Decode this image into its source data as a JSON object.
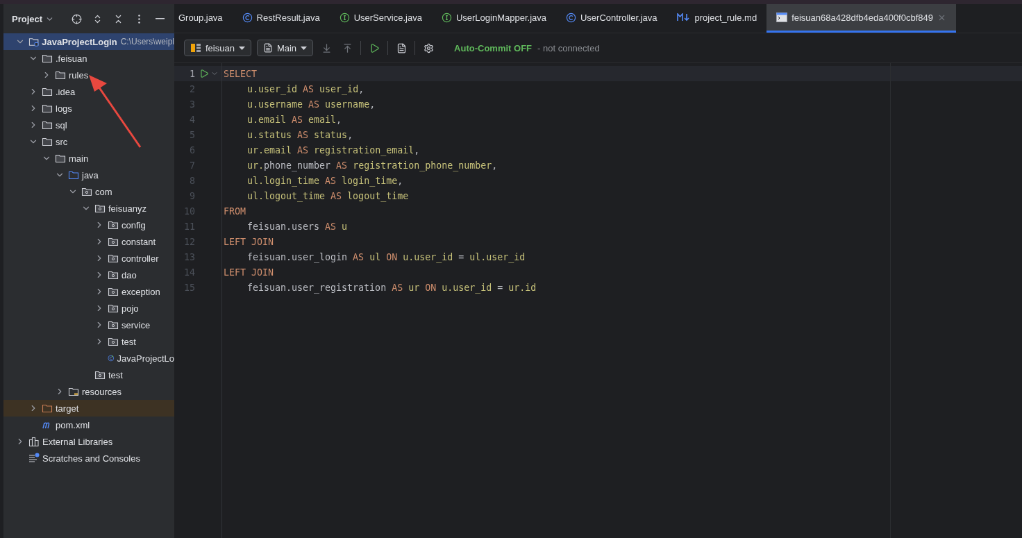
{
  "project_panel": {
    "title": "Project",
    "tree": [
      {
        "label": "JavaProjectLogin",
        "path": "C:\\Users\\weipl",
        "kind": "module",
        "expanded": true,
        "selected": true,
        "children": [
          {
            "label": ".feisuan",
            "kind": "folder",
            "expanded": true,
            "selected": false,
            "children": [
              {
                "label": "rules",
                "kind": "folder",
                "expanded": false,
                "selected": false
              }
            ]
          },
          {
            "label": ".idea",
            "kind": "folder",
            "expanded": false,
            "selected": false
          },
          {
            "label": "logs",
            "kind": "folder",
            "expanded": false,
            "selected": false
          },
          {
            "label": "sql",
            "kind": "folder",
            "expanded": false,
            "selected": false
          },
          {
            "label": "src",
            "kind": "folder",
            "expanded": true,
            "selected": false,
            "children": [
              {
                "label": "main",
                "kind": "folder",
                "expanded": true,
                "selected": false,
                "children": [
                  {
                    "label": "java",
                    "kind": "source",
                    "expanded": true,
                    "selected": false,
                    "children": [
                      {
                        "label": "com",
                        "kind": "package",
                        "expanded": true,
                        "selected": false,
                        "children": [
                          {
                            "label": "feisuanyz",
                            "kind": "package",
                            "expanded": true,
                            "selected": false,
                            "children": [
                              {
                                "label": "config",
                                "kind": "package",
                                "expanded": false,
                                "selected": false
                              },
                              {
                                "label": "constant",
                                "kind": "package",
                                "expanded": false,
                                "selected": false
                              },
                              {
                                "label": "controller",
                                "kind": "package",
                                "expanded": false,
                                "selected": false
                              },
                              {
                                "label": "dao",
                                "kind": "package",
                                "expanded": false,
                                "selected": false
                              },
                              {
                                "label": "exception",
                                "kind": "package",
                                "expanded": false,
                                "selected": false
                              },
                              {
                                "label": "pojo",
                                "kind": "package",
                                "expanded": false,
                                "selected": false
                              },
                              {
                                "label": "service",
                                "kind": "package",
                                "expanded": false,
                                "selected": false
                              },
                              {
                                "label": "test",
                                "kind": "package",
                                "expanded": false,
                                "selected": false
                              },
                              {
                                "label": "JavaProjectLo",
                                "kind": "class",
                                "selected": false
                              }
                            ]
                          },
                          {
                            "label": "test",
                            "kind": "package",
                            "selected": false
                          }
                        ]
                      }
                    ]
                  },
                  {
                    "label": "resources",
                    "kind": "resources",
                    "expanded": false,
                    "selected": false
                  }
                ]
              }
            ]
          },
          {
            "label": "target",
            "kind": "excluded",
            "expanded": false,
            "selected": false
          },
          {
            "label": "pom.xml",
            "kind": "maven",
            "selected": false
          }
        ]
      },
      {
        "label": "External Libraries",
        "kind": "libraries",
        "expanded": false,
        "selected": false
      },
      {
        "label": "Scratches and Consoles",
        "kind": "scratches",
        "selected": false
      }
    ]
  },
  "tabs": [
    {
      "label": "Group.java",
      "kind": "plain",
      "selected": false
    },
    {
      "label": "RestResult.java",
      "kind": "class",
      "selected": false
    },
    {
      "label": "UserService.java",
      "kind": "interface",
      "selected": false
    },
    {
      "label": "UserLoginMapper.java",
      "kind": "interface",
      "selected": false
    },
    {
      "label": "UserController.java",
      "kind": "class",
      "selected": false
    },
    {
      "label": "project_rule.md",
      "kind": "markdown",
      "selected": false
    },
    {
      "label": "feisuan68a428dfb4eda400f0cbf849",
      "kind": "console",
      "selected": true
    }
  ],
  "toolbar": {
    "datasource": "feisuan",
    "session": "Main",
    "auto_commit": "Auto-Commit OFF",
    "status": "- not connected"
  },
  "editor": {
    "lines": [
      {
        "n": "1",
        "current": true,
        "indent": false,
        "tokens": [
          {
            "kind": "kw",
            "text": "SELECT"
          }
        ]
      },
      {
        "n": "2",
        "current": false,
        "indent": true,
        "tokens": [
          {
            "kind": "col",
            "text": "u.user_id"
          },
          {
            "kind": "kw",
            "text": " AS "
          },
          {
            "kind": "col",
            "text": "user_id"
          },
          {
            "kind": "plain",
            "text": ","
          }
        ]
      },
      {
        "n": "3",
        "current": false,
        "indent": true,
        "tokens": [
          {
            "kind": "col",
            "text": "u.username"
          },
          {
            "kind": "kw",
            "text": " AS "
          },
          {
            "kind": "col",
            "text": "username"
          },
          {
            "kind": "plain",
            "text": ","
          }
        ]
      },
      {
        "n": "4",
        "current": false,
        "indent": true,
        "tokens": [
          {
            "kind": "col",
            "text": "u.email"
          },
          {
            "kind": "kw",
            "text": " AS "
          },
          {
            "kind": "col",
            "text": "email"
          },
          {
            "kind": "plain",
            "text": ","
          }
        ]
      },
      {
        "n": "5",
        "current": false,
        "indent": true,
        "tokens": [
          {
            "kind": "col",
            "text": "u.status"
          },
          {
            "kind": "kw",
            "text": " AS "
          },
          {
            "kind": "col",
            "text": "status"
          },
          {
            "kind": "plain",
            "text": ","
          }
        ]
      },
      {
        "n": "6",
        "current": false,
        "indent": true,
        "tokens": [
          {
            "kind": "col",
            "text": "ur.email"
          },
          {
            "kind": "kw",
            "text": " AS "
          },
          {
            "kind": "col",
            "text": "registration_email"
          },
          {
            "kind": "plain",
            "text": ","
          }
        ]
      },
      {
        "n": "7",
        "current": false,
        "indent": true,
        "tokens": [
          {
            "kind": "col",
            "text": "ur."
          },
          {
            "kind": "plain",
            "text": "phone_number"
          },
          {
            "kind": "kw",
            "text": " AS "
          },
          {
            "kind": "col",
            "text": "registration_phone_number"
          },
          {
            "kind": "plain",
            "text": ","
          }
        ]
      },
      {
        "n": "8",
        "current": false,
        "indent": true,
        "tokens": [
          {
            "kind": "col",
            "text": "ul.login_time"
          },
          {
            "kind": "kw",
            "text": " AS "
          },
          {
            "kind": "col",
            "text": "login_time"
          },
          {
            "kind": "plain",
            "text": ","
          }
        ]
      },
      {
        "n": "9",
        "current": false,
        "indent": true,
        "tokens": [
          {
            "kind": "col",
            "text": "ul.logout_time"
          },
          {
            "kind": "kw",
            "text": " AS "
          },
          {
            "kind": "col",
            "text": "logout_time"
          }
        ]
      },
      {
        "n": "10",
        "current": false,
        "indent": false,
        "tokens": [
          {
            "kind": "kw",
            "text": "FROM"
          }
        ]
      },
      {
        "n": "11",
        "current": false,
        "indent": true,
        "tokens": [
          {
            "kind": "plain",
            "text": "feisuan.users"
          },
          {
            "kind": "kw",
            "text": " AS "
          },
          {
            "kind": "col",
            "text": "u"
          }
        ]
      },
      {
        "n": "12",
        "current": false,
        "indent": false,
        "tokens": [
          {
            "kind": "kw",
            "text": "LEFT JOIN"
          }
        ]
      },
      {
        "n": "13",
        "current": false,
        "indent": true,
        "tokens": [
          {
            "kind": "plain",
            "text": "feisuan.user_login"
          },
          {
            "kind": "kw",
            "text": " AS "
          },
          {
            "kind": "col",
            "text": "ul"
          },
          {
            "kind": "kw",
            "text": " ON "
          },
          {
            "kind": "col",
            "text": "u.user_id"
          },
          {
            "kind": "plain",
            "text": " = "
          },
          {
            "kind": "col",
            "text": "ul.user_id"
          }
        ]
      },
      {
        "n": "14",
        "current": false,
        "indent": false,
        "tokens": [
          {
            "kind": "kw",
            "text": "LEFT JOIN"
          }
        ]
      },
      {
        "n": "15",
        "current": false,
        "indent": true,
        "tokens": [
          {
            "kind": "plain",
            "text": "feisuan.user_registration"
          },
          {
            "kind": "kw",
            "text": " AS "
          },
          {
            "kind": "col",
            "text": "ur"
          },
          {
            "kind": "kw",
            "text": " ON "
          },
          {
            "kind": "col",
            "text": "u.user_id"
          },
          {
            "kind": "plain",
            "text": " = "
          },
          {
            "kind": "col",
            "text": "ur.id"
          }
        ]
      }
    ]
  }
}
